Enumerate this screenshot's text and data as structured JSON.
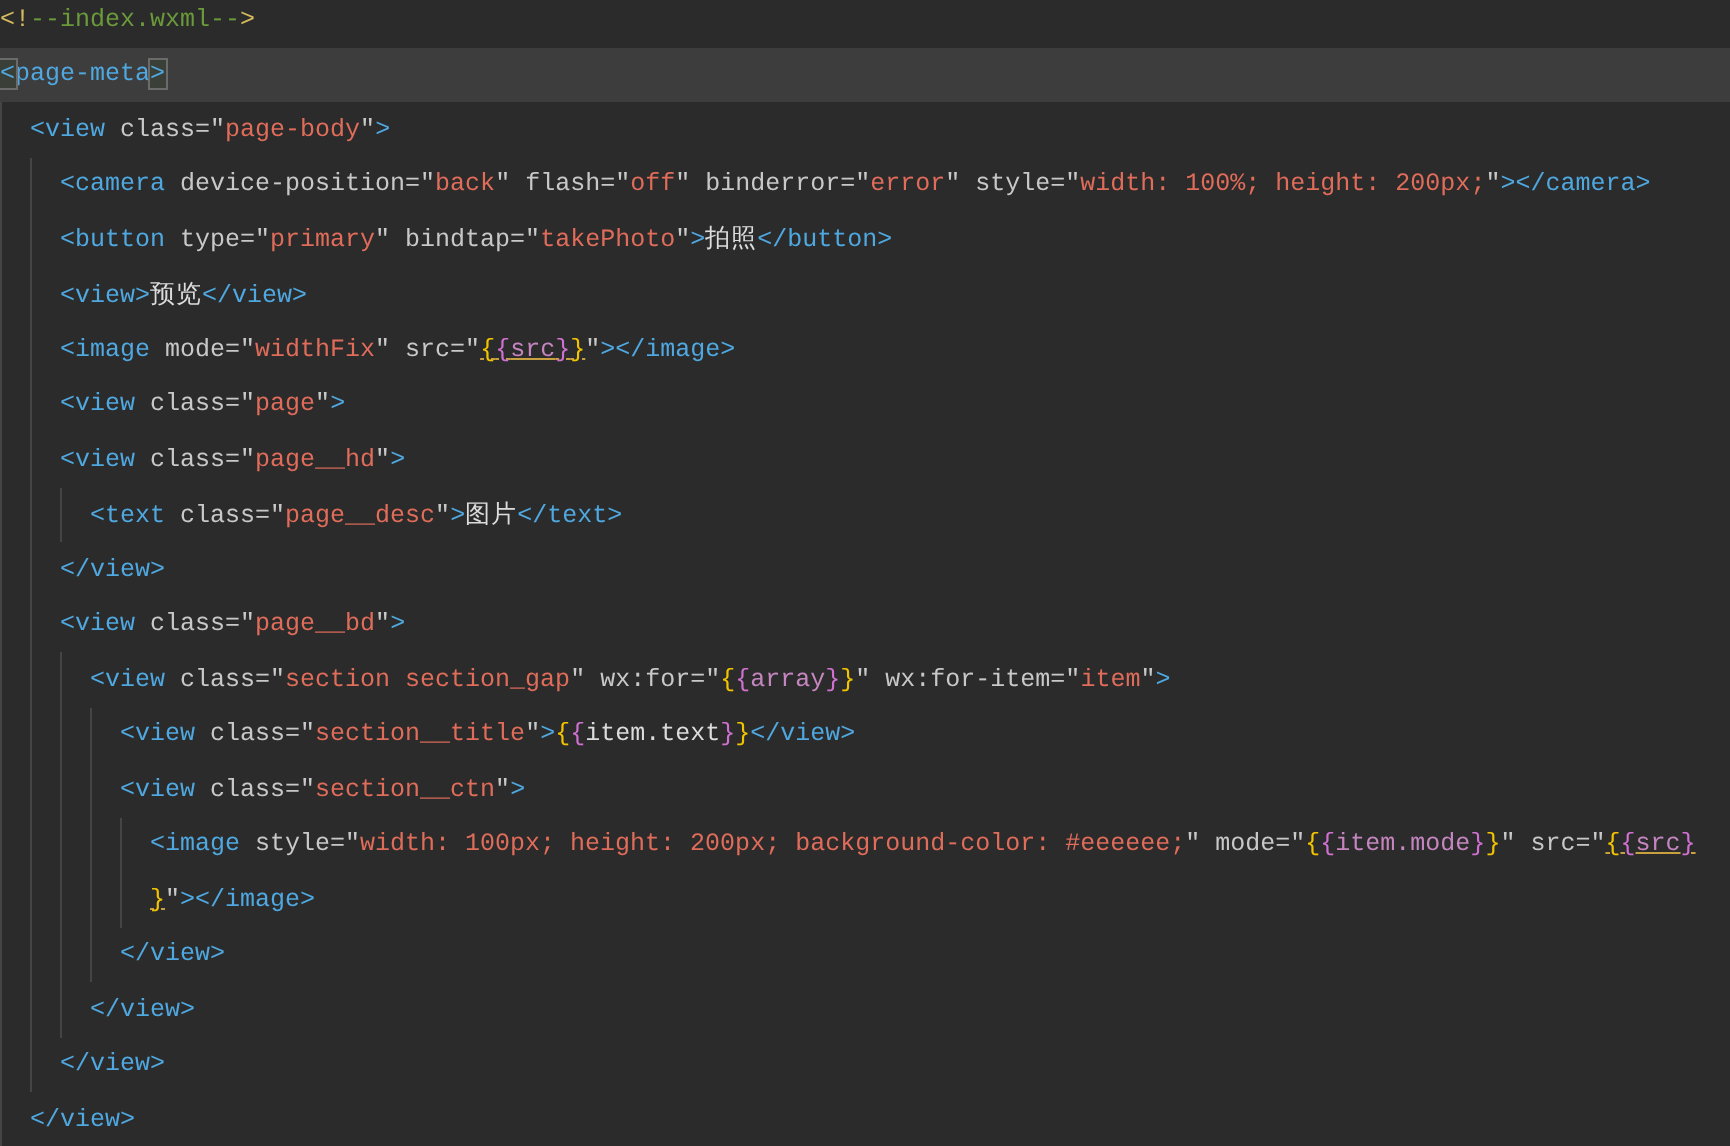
{
  "lines": [
    {
      "current": false,
      "tokens": [
        {
          "kind": "comment-punct",
          "text": "<!"
        },
        {
          "kind": "comment",
          "text": "--index.wxml--"
        },
        {
          "kind": "comment-punct",
          "text": ">"
        }
      ]
    },
    {
      "current": true,
      "tokens": [
        {
          "kind": "tag-match",
          "text": "<"
        },
        {
          "kind": "tag",
          "text": "page-meta"
        },
        {
          "kind": "tag-match",
          "text": ">"
        }
      ],
      "children": [
        {
          "current": false,
          "tokens": [
            {
              "kind": "tag",
              "text": "<view"
            },
            {
              "kind": "attr",
              "text": " class=\""
            },
            {
              "kind": "string",
              "text": "page-body"
            },
            {
              "kind": "attr",
              "text": "\""
            },
            {
              "kind": "tag",
              "text": ">"
            }
          ],
          "children": [
            {
              "current": false,
              "tokens": [
                {
                  "kind": "tag",
                  "text": "<camera"
                },
                {
                  "kind": "attr",
                  "text": " device-position=\""
                },
                {
                  "kind": "string",
                  "text": "back"
                },
                {
                  "kind": "attr",
                  "text": "\" flash=\""
                },
                {
                  "kind": "string",
                  "text": "off"
                },
                {
                  "kind": "attr",
                  "text": "\" binderror=\""
                },
                {
                  "kind": "string",
                  "text": "error"
                },
                {
                  "kind": "attr",
                  "text": "\" style=\""
                },
                {
                  "kind": "string",
                  "text": "width: 100%; height: 200px;"
                },
                {
                  "kind": "attr",
                  "text": "\""
                },
                {
                  "kind": "tag",
                  "text": "></camera>"
                }
              ]
            },
            {
              "current": false,
              "tokens": [
                {
                  "kind": "tag",
                  "text": "<button"
                },
                {
                  "kind": "attr",
                  "text": " type=\""
                },
                {
                  "kind": "string",
                  "text": "primary"
                },
                {
                  "kind": "attr",
                  "text": "\" bindtap=\""
                },
                {
                  "kind": "string",
                  "text": "takePhoto"
                },
                {
                  "kind": "attr",
                  "text": "\""
                },
                {
                  "kind": "tag",
                  "text": ">"
                },
                {
                  "kind": "text",
                  "text": "拍照"
                },
                {
                  "kind": "tag",
                  "text": "</button>"
                }
              ]
            },
            {
              "current": false,
              "tokens": [
                {
                  "kind": "tag",
                  "text": "<view>"
                },
                {
                  "kind": "text",
                  "text": "预览"
                },
                {
                  "kind": "tag",
                  "text": "</view>"
                }
              ]
            },
            {
              "current": false,
              "tokens": [
                {
                  "kind": "tag",
                  "text": "<image"
                },
                {
                  "kind": "attr",
                  "text": " mode=\""
                },
                {
                  "kind": "string",
                  "text": "widthFix"
                },
                {
                  "kind": "attr",
                  "text": "\" src=\""
                },
                {
                  "kind": "brace1-u",
                  "text": "{"
                },
                {
                  "kind": "brace2-u",
                  "text": "{"
                },
                {
                  "kind": "expr-u",
                  "text": "src"
                },
                {
                  "kind": "brace2-u",
                  "text": "}"
                },
                {
                  "kind": "brace1-u",
                  "text": "}"
                },
                {
                  "kind": "attr",
                  "text": "\""
                },
                {
                  "kind": "tag",
                  "text": "></image>"
                }
              ]
            },
            {
              "current": false,
              "tokens": [
                {
                  "kind": "tag",
                  "text": "<view"
                },
                {
                  "kind": "attr",
                  "text": " class=\""
                },
                {
                  "kind": "string",
                  "text": "page"
                },
                {
                  "kind": "attr",
                  "text": "\""
                },
                {
                  "kind": "tag",
                  "text": ">"
                }
              ]
            },
            {
              "current": false,
              "tokens": [
                {
                  "kind": "tag",
                  "text": "<view"
                },
                {
                  "kind": "attr",
                  "text": " class=\""
                },
                {
                  "kind": "string",
                  "text": "page__hd"
                },
                {
                  "kind": "attr",
                  "text": "\""
                },
                {
                  "kind": "tag",
                  "text": ">"
                }
              ],
              "children": [
                {
                  "current": false,
                  "tokens": [
                    {
                      "kind": "tag",
                      "text": "<text"
                    },
                    {
                      "kind": "attr",
                      "text": " class=\""
                    },
                    {
                      "kind": "string",
                      "text": "page__desc"
                    },
                    {
                      "kind": "attr",
                      "text": "\""
                    },
                    {
                      "kind": "tag",
                      "text": ">"
                    },
                    {
                      "kind": "text",
                      "text": "图片"
                    },
                    {
                      "kind": "tag",
                      "text": "</text>"
                    }
                  ]
                }
              ]
            },
            {
              "current": false,
              "tokens": [
                {
                  "kind": "tag",
                  "text": "</view>"
                }
              ]
            },
            {
              "current": false,
              "tokens": [
                {
                  "kind": "tag",
                  "text": "<view"
                },
                {
                  "kind": "attr",
                  "text": " class=\""
                },
                {
                  "kind": "string",
                  "text": "page__bd"
                },
                {
                  "kind": "attr",
                  "text": "\""
                },
                {
                  "kind": "tag",
                  "text": ">"
                }
              ],
              "children": [
                {
                  "current": false,
                  "tokens": [
                    {
                      "kind": "tag",
                      "text": "<view"
                    },
                    {
                      "kind": "attr",
                      "text": " class=\""
                    },
                    {
                      "kind": "string",
                      "text": "section section_gap"
                    },
                    {
                      "kind": "attr",
                      "text": "\" wx:for=\""
                    },
                    {
                      "kind": "brace1",
                      "text": "{"
                    },
                    {
                      "kind": "brace2",
                      "text": "{"
                    },
                    {
                      "kind": "expr",
                      "text": "array"
                    },
                    {
                      "kind": "brace2",
                      "text": "}"
                    },
                    {
                      "kind": "brace1",
                      "text": "}"
                    },
                    {
                      "kind": "attr",
                      "text": "\" wx:for-item=\""
                    },
                    {
                      "kind": "string",
                      "text": "item"
                    },
                    {
                      "kind": "attr",
                      "text": "\""
                    },
                    {
                      "kind": "tag",
                      "text": ">"
                    }
                  ],
                  "children": [
                    {
                      "current": false,
                      "tokens": [
                        {
                          "kind": "tag",
                          "text": "<view"
                        },
                        {
                          "kind": "attr",
                          "text": " class=\""
                        },
                        {
                          "kind": "string",
                          "text": "section__title"
                        },
                        {
                          "kind": "attr",
                          "text": "\""
                        },
                        {
                          "kind": "tag",
                          "text": ">"
                        },
                        {
                          "kind": "brace1",
                          "text": "{"
                        },
                        {
                          "kind": "brace2",
                          "text": "{"
                        },
                        {
                          "kind": "text",
                          "text": "item.text"
                        },
                        {
                          "kind": "brace2",
                          "text": "}"
                        },
                        {
                          "kind": "brace1",
                          "text": "}"
                        },
                        {
                          "kind": "tag",
                          "text": "</view>"
                        }
                      ]
                    },
                    {
                      "current": false,
                      "tokens": [
                        {
                          "kind": "tag",
                          "text": "<view"
                        },
                        {
                          "kind": "attr",
                          "text": " class=\""
                        },
                        {
                          "kind": "string",
                          "text": "section__ctn"
                        },
                        {
                          "kind": "attr",
                          "text": "\""
                        },
                        {
                          "kind": "tag",
                          "text": ">"
                        }
                      ],
                      "children": [
                        {
                          "current": false,
                          "tokens": [
                            {
                              "kind": "tag",
                              "text": "<image"
                            },
                            {
                              "kind": "attr",
                              "text": " style=\""
                            },
                            {
                              "kind": "string",
                              "text": "width: 100px; height: 200px; background-color: #eeeeee;"
                            },
                            {
                              "kind": "attr",
                              "text": "\" mode=\""
                            },
                            {
                              "kind": "brace1",
                              "text": "{"
                            },
                            {
                              "kind": "brace2",
                              "text": "{"
                            },
                            {
                              "kind": "expr",
                              "text": "item.mode"
                            },
                            {
                              "kind": "brace2",
                              "text": "}"
                            },
                            {
                              "kind": "brace1",
                              "text": "}"
                            },
                            {
                              "kind": "attr",
                              "text": "\" src=\""
                            },
                            {
                              "kind": "brace1-u",
                              "text": "{"
                            },
                            {
                              "kind": "brace2-u",
                              "text": "{"
                            },
                            {
                              "kind": "expr-u",
                              "text": "src"
                            },
                            {
                              "kind": "brace2-u",
                              "text": "}"
                            }
                          ]
                        },
                        {
                          "current": false,
                          "tokens": [
                            {
                              "kind": "brace1-u",
                              "text": "}"
                            },
                            {
                              "kind": "attr",
                              "text": "\""
                            },
                            {
                              "kind": "tag",
                              "text": "></image>"
                            }
                          ]
                        }
                      ]
                    },
                    {
                      "current": false,
                      "tokens": [
                        {
                          "kind": "tag",
                          "text": "</view>"
                        }
                      ]
                    }
                  ]
                },
                {
                  "current": false,
                  "tokens": [
                    {
                      "kind": "tag",
                      "text": "</view>"
                    }
                  ]
                }
              ]
            },
            {
              "current": false,
              "tokens": [
                {
                  "kind": "tag",
                  "text": "</view>"
                }
              ]
            }
          ]
        },
        {
          "current": false,
          "tokens": [
            {
              "kind": "tag",
              "text": "</view>"
            }
          ]
        }
      ]
    }
  ]
}
